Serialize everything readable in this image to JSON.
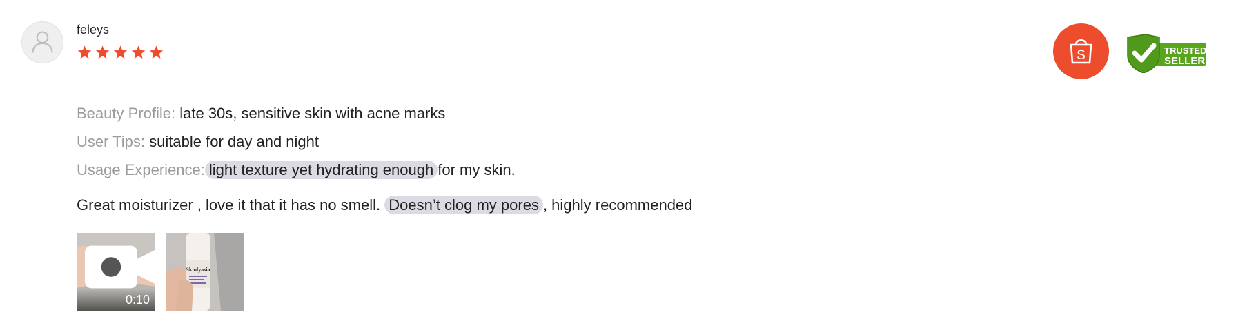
{
  "review": {
    "username": "feleys",
    "rating": 5,
    "rating_max": 5,
    "beauty_profile_label": "Beauty Profile:",
    "beauty_profile_value": "late 30s, sensitive skin with acne marks",
    "user_tips_label": "User Tips:",
    "user_tips_value": "suitable for day and night",
    "usage_label": "Usage Experience:",
    "usage_highlight": "light texture yet hydrating enough",
    "usage_rest": "for my skin.",
    "comment_start": "Great moisturizer , love it that it has no smell.",
    "comment_highlight": "Doesn’t clog my pores",
    "comment_end": ", highly recommended"
  },
  "media": {
    "video_duration": "0:10",
    "video_icon": "video-camera-icon",
    "photo_product_text": "Skinlyasia"
  },
  "badges": {
    "shop_icon": "shopee-bag-icon",
    "shop_letter": "S",
    "trusted_line1": "TRUSTED",
    "trusted_line2": "SELLER"
  },
  "colors": {
    "star": "#ee4d2d",
    "shop": "#ee4d2d",
    "highlight": "#dcdae3",
    "trusted_green": "#5aa51f"
  }
}
